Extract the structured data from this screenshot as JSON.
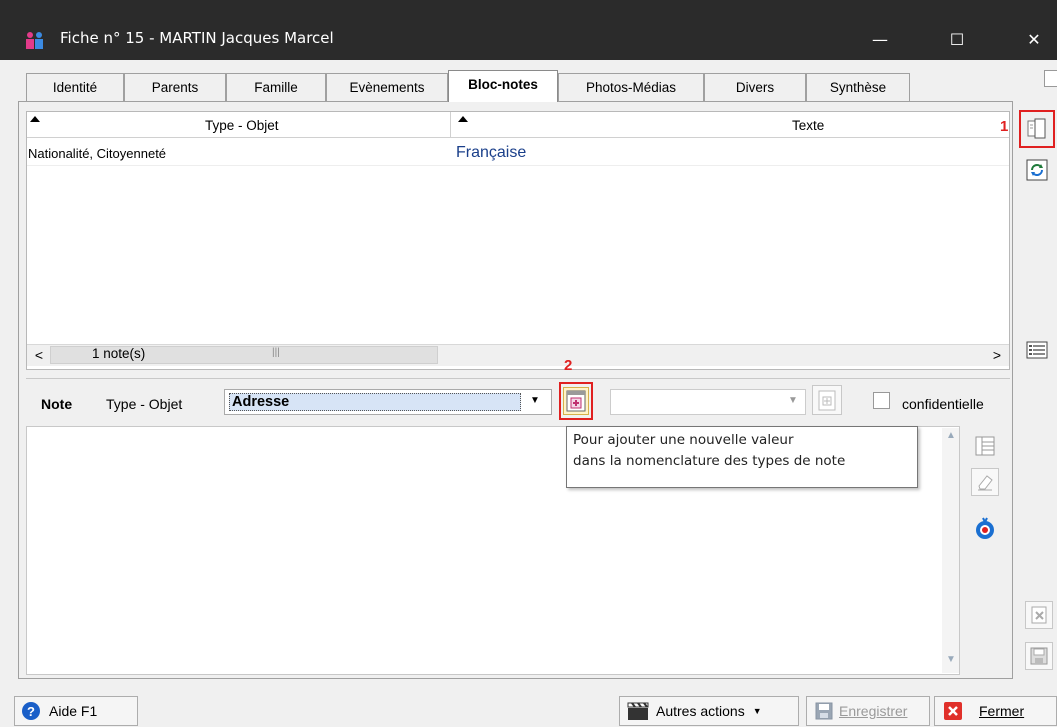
{
  "window": {
    "title": "Fiche n° 15  -  MARTIN Jacques Marcel",
    "minimize_glyph": "—",
    "maximize_glyph": "☐",
    "close_glyph": "✕"
  },
  "tabs": [
    {
      "label": "Identité"
    },
    {
      "label": "Parents"
    },
    {
      "label": "Famille"
    },
    {
      "label": "Evènements"
    },
    {
      "label": "Bloc-notes"
    },
    {
      "label": "Photos-Médias"
    },
    {
      "label": "Divers"
    },
    {
      "label": "Synthèse"
    }
  ],
  "active_tab": "Bloc-notes",
  "grid": {
    "columns": [
      "Type - Objet",
      "Texte"
    ],
    "rows": [
      {
        "type": "Nationalité, Citoyenneté",
        "text": "Française"
      }
    ],
    "count_label": "1  note(s)",
    "grip": "|||"
  },
  "annotations": {
    "one": "1",
    "two": "2"
  },
  "note_editor": {
    "label": "Note",
    "type_label": "Type - Objet",
    "type_value": "Adresse",
    "secondary_value": "",
    "confidential_label": "confidentielle",
    "confidential_checked": false
  },
  "tooltip": {
    "line1": "Pour ajouter une nouvelle valeur",
    "line2": "dans la nomenclature des types de note"
  },
  "footer": {
    "help_label": "Aide  F1",
    "other_actions_label": "Autres actions",
    "save_label": "Enregistrer",
    "close_label": "Fermer"
  },
  "colors": {
    "titlebar": "#2b2b2b",
    "annotation_red": "#e02020",
    "text_value_blue": "#1a3f8a",
    "selection_blue": "#d7e4f6"
  },
  "icons": {
    "window": "people-icon",
    "help": "help-icon",
    "close": "close-icon"
  }
}
